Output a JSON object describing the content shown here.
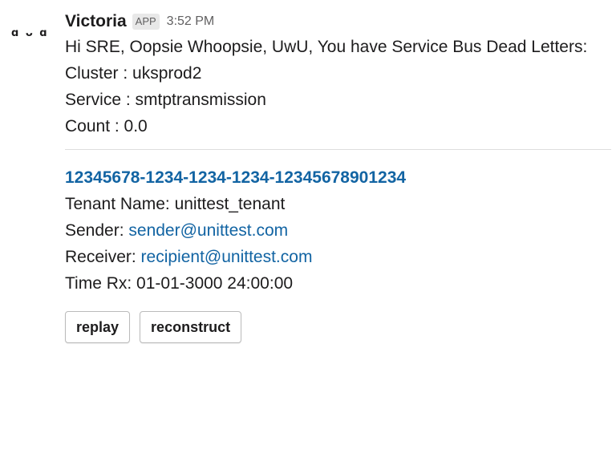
{
  "avatar": {
    "text": "ɑ ᴗ ɑ"
  },
  "message": {
    "sender": "Victoria",
    "badge": "APP",
    "time": "3:52 PM",
    "intro": "Hi SRE, Oopsie Whoopsie, UwU, You have Service Bus Dead Letters:",
    "cluster_line": "Cluster : uksprod2",
    "service_line": "Service : smtptransmission",
    "count_line": "Count : 0.0"
  },
  "attachment": {
    "message_id": "12345678-1234-1234-1234-12345678901234",
    "tenant_line": "Tenant Name: unittest_tenant",
    "sender_label": "Sender: ",
    "sender_email": "sender@unittest.com",
    "receiver_label": "Receiver: ",
    "receiver_email": "recipient@unittest.com",
    "time_line": "Time Rx: 01-01-3000 24:00:00"
  },
  "actions": {
    "replay_label": "replay",
    "reconstruct_label": "reconstruct"
  },
  "colors": {
    "link": "#1264a3",
    "text": "#1d1c1d",
    "muted": "#616061"
  }
}
